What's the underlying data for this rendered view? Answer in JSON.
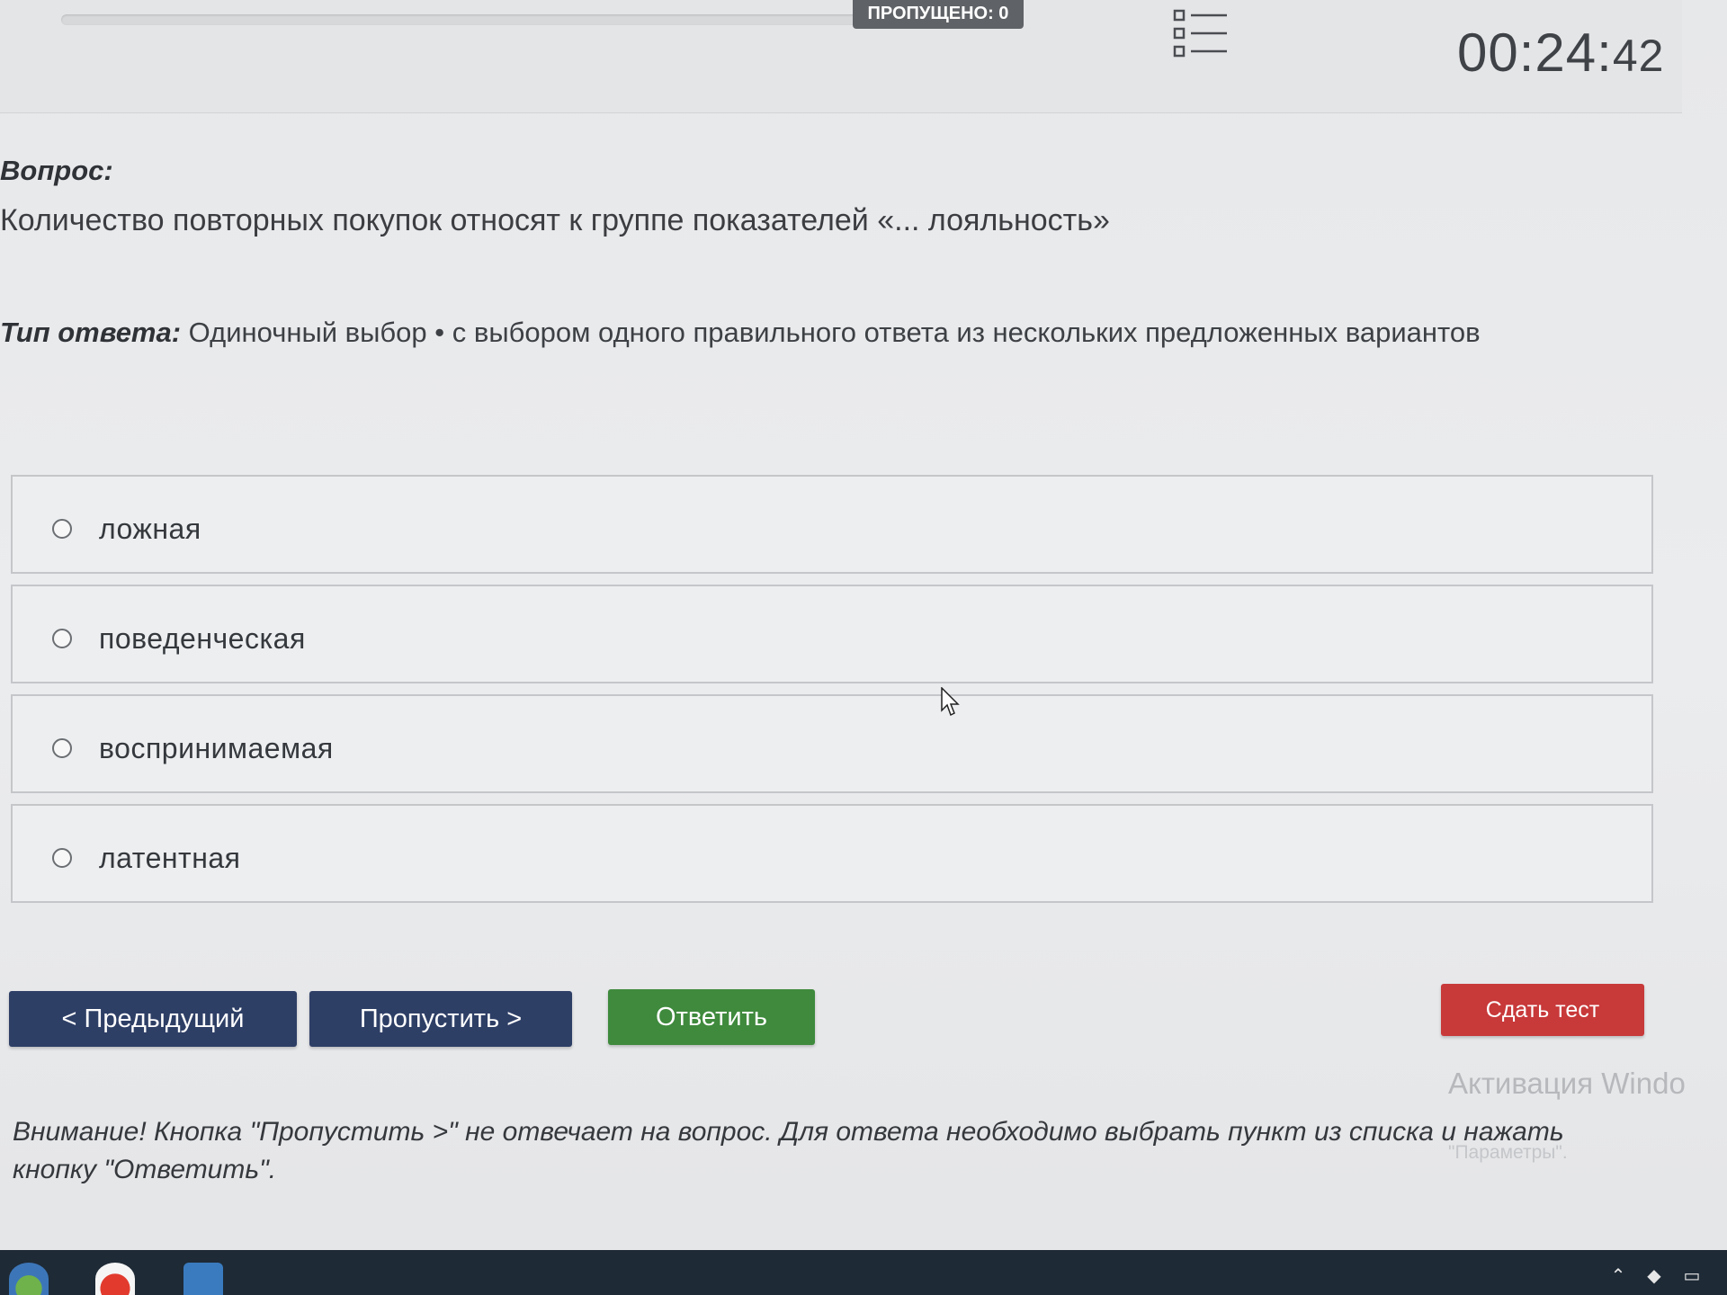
{
  "header": {
    "skipped_label": "ПРОПУЩЕНО: 0",
    "timer_main": "00:24:",
    "timer_seconds": "42",
    "question_list_icon": "list-icon"
  },
  "question": {
    "label": "Вопрос:",
    "text": "Количество повторных покупок относят к группе показателей «... лояльность»",
    "type_label": "Тип ответа:",
    "type_value": " Одиночный выбор • с выбором одного правильного ответа из нескольких предложенных вариантов"
  },
  "options": [
    {
      "label": "ложная"
    },
    {
      "label": "поведенческая"
    },
    {
      "label": "воспринимаемая"
    },
    {
      "label": "латентная"
    }
  ],
  "buttons": {
    "prev": "< Предыдущий",
    "skip": "Пропустить >",
    "answer": "Ответить",
    "finish": "Сдать тест"
  },
  "notice": "Внимание! Кнопка \"Пропустить >\" не отвечает на вопрос. Для ответа необходимо выбрать пункт из списка и нажать кнопку \"Ответить\".",
  "watermark": {
    "title": "Активация Windo",
    "line2": "\"Параметры\"."
  },
  "colors": {
    "nav_button": "#2e3f66",
    "answer_button": "#3f8a3d",
    "finish_button": "#c8393a",
    "badge": "#5f6266",
    "taskbar": "#1e2a36"
  }
}
